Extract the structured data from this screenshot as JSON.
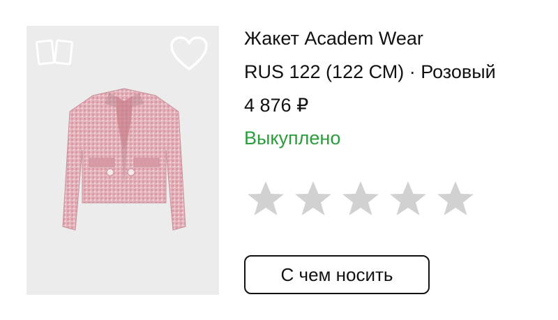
{
  "product": {
    "title": "Жакет Academ Wear",
    "variant": "RUS 122 (122 СМ) · Розовый",
    "price": "4 876 ₽",
    "status": "Выкуплено",
    "image_alt": "pink tweed cropped jacket"
  },
  "rating": {
    "value": 0,
    "max": 5
  },
  "outfit_button": {
    "label": "С чем носить"
  },
  "icons": {
    "compare": "compare-cards-icon",
    "favorite": "heart-icon",
    "star": "star-icon"
  },
  "colors": {
    "status_green": "#2a9d39",
    "star_empty": "#d1d1d1",
    "image_bg": "#ececec",
    "jacket": "#e3b4bb",
    "text": "#111111"
  }
}
